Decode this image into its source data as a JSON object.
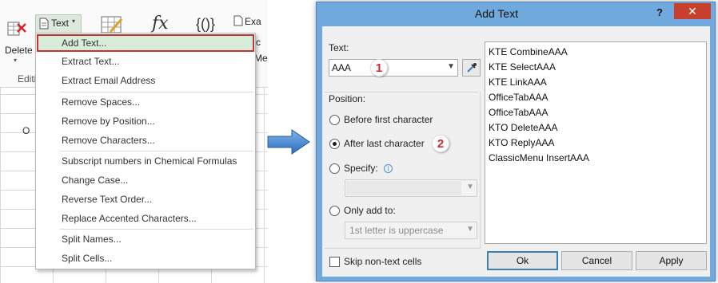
{
  "ribbon": {
    "delete_label": "Delete",
    "editing_label": "Editi",
    "text_button_label": "Text",
    "extract_label": "Exa",
    "formula_label": "fx",
    "brace_label": "{()}",
    "ma_label": "Me",
    "c_label": "c",
    "column_letter": "O"
  },
  "menu": {
    "items": [
      {
        "label": "Add Text..."
      },
      {
        "label": "Extract Text..."
      },
      {
        "label": "Extract Email Address"
      },
      {
        "label": "Remove Spaces..."
      },
      {
        "label": "Remove by Position..."
      },
      {
        "label": "Remove Characters..."
      },
      {
        "label": "Subscript numbers in Chemical Formulas"
      },
      {
        "label": "Change Case..."
      },
      {
        "label": "Reverse Text Order..."
      },
      {
        "label": "Replace Accented Characters..."
      },
      {
        "label": "Split Names..."
      },
      {
        "label": "Split Cells..."
      }
    ]
  },
  "dialog": {
    "title": "Add Text",
    "help_label": "?",
    "close_label": "✕",
    "text_label": "Text:",
    "text_value": "AAA",
    "position_label": "Position:",
    "options": {
      "before": "Before first character",
      "after": "After last character",
      "specify": "Specify:",
      "only_add": "Only add to:"
    },
    "specify_value": "",
    "only_add_value": "1st letter is uppercase",
    "skip_label": "Skip non-text cells",
    "preview": [
      "KTE CombineAAA",
      "KTE SelectAAA",
      "KTE LinkAAA",
      "OfficeTabAAA",
      "OfficeTabAAA",
      "KTO DeleteAAA",
      "KTO ReplyAAA",
      "ClassicMenu InsertAAA"
    ],
    "buttons": {
      "ok": "Ok",
      "cancel": "Cancel",
      "apply": "Apply"
    },
    "step_badges": {
      "one": "1",
      "two": "2"
    }
  },
  "colors": {
    "accent_red": "#d8232a",
    "highlight_green": "#d7ecd9",
    "dialog_frame": "#6fa9de",
    "close_red": "#c7402e",
    "arrow_blue": "#3a78c4"
  }
}
